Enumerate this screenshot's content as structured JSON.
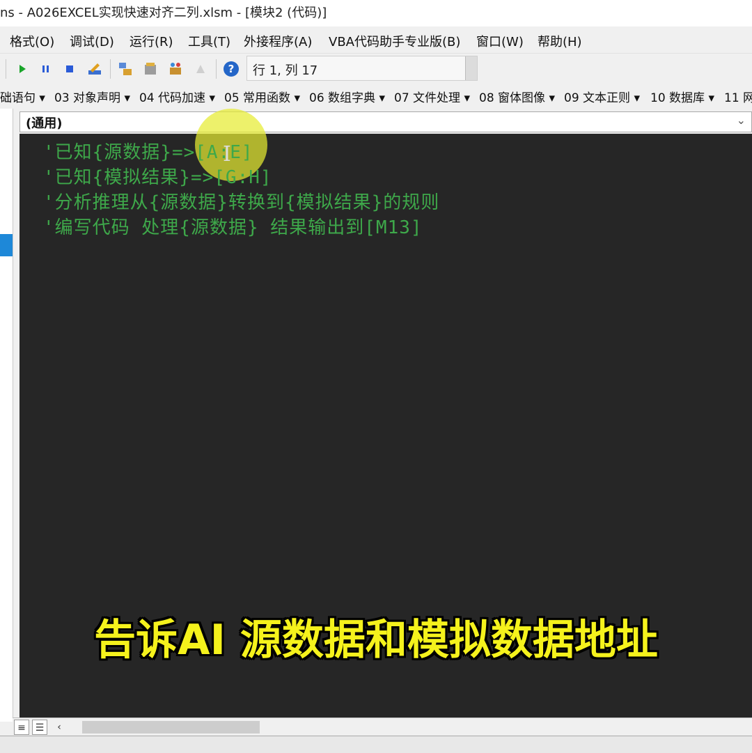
{
  "window": {
    "title": "ns - A026EXCEL实现快速对齐二列.xlsm - [模块2 (代码)]"
  },
  "menu": [
    {
      "label": "格式(O)"
    },
    {
      "label": "调试(D)"
    },
    {
      "label": "运行(R)"
    },
    {
      "label": "工具(T)"
    },
    {
      "label": "外接程序(A)"
    },
    {
      "label": "VBA代码助手专业版(B)"
    },
    {
      "label": "窗口(W)"
    },
    {
      "label": "帮助(H)"
    }
  ],
  "toolbar": {
    "icons": [
      "run-icon",
      "pause-icon",
      "stop-icon",
      "design-mode-icon",
      "project-explorer-icon",
      "properties-icon",
      "object-browser-icon",
      "toolbox-icon",
      "help-icon"
    ],
    "position": "行 1, 列 17"
  },
  "snippets": [
    {
      "label": "础语句 ▾"
    },
    {
      "label": "03 对象声明 ▾"
    },
    {
      "label": "04 代码加速 ▾"
    },
    {
      "label": "05 常用函数 ▾"
    },
    {
      "label": "06 数组字典 ▾"
    },
    {
      "label": "07 文件处理 ▾"
    },
    {
      "label": "08 窗体图像 ▾"
    },
    {
      "label": "09 文本正则 ▾"
    },
    {
      "label": "10 数据库 ▾"
    },
    {
      "label": "11 网"
    }
  ],
  "object_selector": {
    "value": "(通用)"
  },
  "code_lines": [
    "'已知{源数据}=>[A:E]",
    "'已知{模拟结果}=>[G:H]",
    "'分析推理从{源数据}转换到{模拟结果}的规则",
    "'编写代码 处理{源数据} 结果输出到[M13]"
  ],
  "caption": "告诉AI 源数据和模拟数据地址",
  "colors": {
    "editor_bg": "#262626",
    "comment": "#3ea84a",
    "caption": "#f5f21c",
    "highlight": "#e6eb32"
  }
}
